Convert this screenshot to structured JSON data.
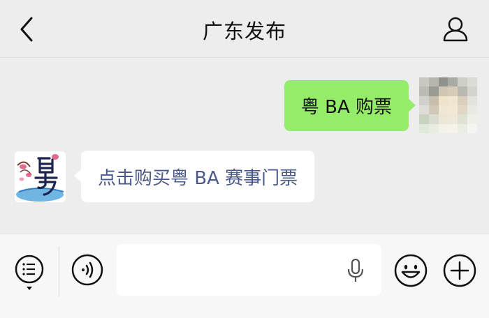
{
  "header": {
    "title": "广东发布",
    "back_icon": "chevron-left-icon",
    "profile_icon": "person-icon"
  },
  "messages": [
    {
      "direction": "outgoing",
      "text": "粤 BA 购票",
      "bubble_color": "#95ec69"
    },
    {
      "direction": "incoming",
      "text": "点击购买粤 BA 赛事门票",
      "text_color": "#4a5a8c"
    }
  ],
  "input_bar": {
    "menu_icon": "menu-list-icon",
    "voice_icon": "voice-icon",
    "mic_icon": "microphone-icon",
    "emoji_icon": "emoji-icon",
    "plus_icon": "plus-icon",
    "value": ""
  },
  "colors": {
    "background": "#ededed",
    "accent_green": "#95ec69",
    "link_blue": "#4a5a8c"
  }
}
